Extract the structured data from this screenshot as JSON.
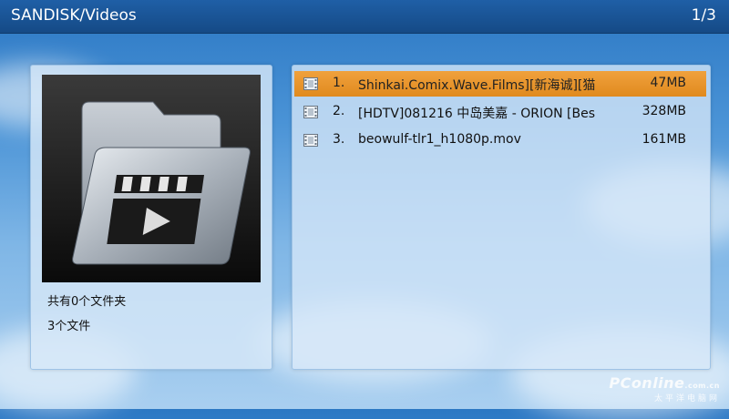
{
  "header": {
    "path": "SANDISK/Videos",
    "page": "1/3"
  },
  "preview": {
    "icon": "video-folder-icon",
    "folder_count": "共有0个文件夹",
    "file_count": "3个文件"
  },
  "files": [
    {
      "index": "1.",
      "name": "Shinkai.Comix.Wave.Films][新海诚][猫",
      "size": "47MB",
      "icon": "film-icon",
      "selected": true
    },
    {
      "index": "2.",
      "name": "[HDTV]081216 中岛美嘉 - ORION [Bes",
      "size": "328MB",
      "icon": "film-icon",
      "selected": false
    },
    {
      "index": "3.",
      "name": "beowulf-tlr1_h1080p.mov",
      "size": "161MB",
      "icon": "film-icon",
      "selected": false
    }
  ],
  "watermark": {
    "brand": "PConline",
    "domain": ".com.cn",
    "tagline": "太平洋电脑网"
  },
  "colors": {
    "selection": "#e8952a",
    "header": "#1a5596",
    "panel": "#d7e8f8"
  }
}
